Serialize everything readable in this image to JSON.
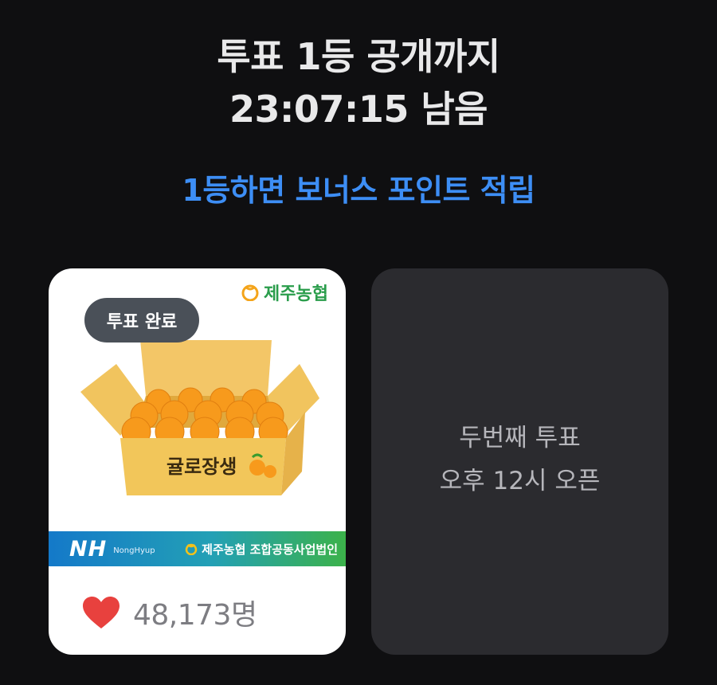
{
  "header": {
    "title_line1": "투표 1등 공개까지",
    "title_line2": "23:07:15 남음",
    "subtitle": "1등하면 보너스 포인트 적립"
  },
  "cards": {
    "first": {
      "badge": "투표 완료",
      "brand_top": "제주농협",
      "product_label": "귤로장생",
      "band_logo": "NH",
      "band_logo_sub": "NongHyup",
      "band_text": "제주농협 조합공동사업법인",
      "votes": "48,173명"
    },
    "second": {
      "line1": "두번째 투표",
      "line2": "오후 12시 오픈"
    }
  },
  "colors": {
    "background": "#0f0f11",
    "accent": "#3d8ef5",
    "heart": "#e8413e",
    "placeholder_card": "#2b2b2f"
  }
}
